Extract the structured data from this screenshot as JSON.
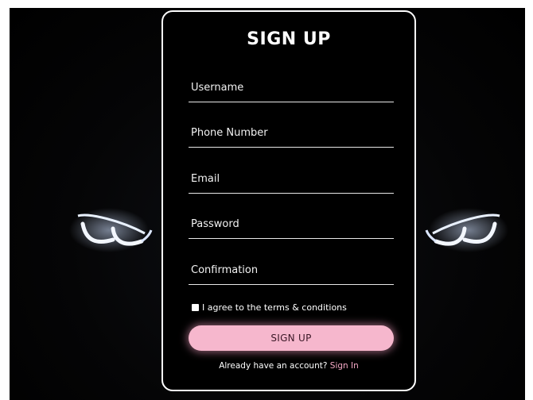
{
  "signup": {
    "title": "SIGN UP",
    "fields": [
      {
        "placeholder": "Username"
      },
      {
        "placeholder": "Phone Number"
      },
      {
        "placeholder": "Email"
      },
      {
        "placeholder": "Password"
      },
      {
        "placeholder": "Confirmation"
      }
    ],
    "terms_label": "I agree to the terms & conditions",
    "submit_label": "SIGN UP",
    "account_prompt": "Already have an account?",
    "signin_link": "Sign In"
  },
  "colors": {
    "background": "#000000",
    "card_border": "#ffffff",
    "button": "#f6b7cd",
    "link": "#f6a9c7"
  }
}
